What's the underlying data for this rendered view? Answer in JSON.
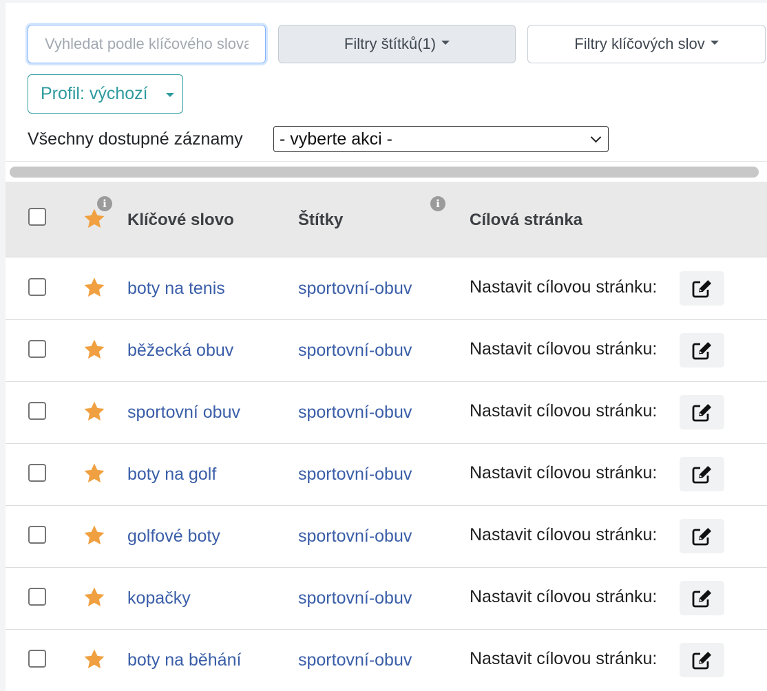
{
  "toolbar": {
    "search_placeholder": "Vyhledat podle klíčového slova",
    "tag_filter_label": "Filtry štítků(1)",
    "keyword_filter_label": "Filtry klíčových slov",
    "profile_label": "Profil: výchozí",
    "bulk_label": "Všechny dostupné záznamy",
    "bulk_action_value": "- vyberte akci -"
  },
  "table": {
    "headers": {
      "keyword": "Klíčové slovo",
      "tags": "Štítky",
      "target_page": "Cílová stránka",
      "info_glyph": "i"
    },
    "rows": [
      {
        "keyword": "boty na tenis",
        "tag": "sportovní-obuv",
        "target_label": "Nastavit cílovou stránku:"
      },
      {
        "keyword": "běžecká obuv",
        "tag": "sportovní-obuv",
        "target_label": "Nastavit cílovou stránku:"
      },
      {
        "keyword": "sportovní obuv",
        "tag": "sportovní-obuv",
        "target_label": "Nastavit cílovou stránku:"
      },
      {
        "keyword": "boty na golf",
        "tag": "sportovní-obuv",
        "target_label": "Nastavit cílovou stránku:"
      },
      {
        "keyword": "golfové boty",
        "tag": "sportovní-obuv",
        "target_label": "Nastavit cílovou stránku:"
      },
      {
        "keyword": "kopačky",
        "tag": "sportovní-obuv",
        "target_label": "Nastavit cílovou stránku:"
      },
      {
        "keyword": "boty na běhání",
        "tag": "sportovní-obuv",
        "target_label": "Nastavit cílovou stránku:"
      }
    ]
  },
  "colors": {
    "link": "#3a5ea8",
    "star": "#f0a040",
    "profile_accent": "#2f9a9e",
    "header_bg": "#e9e9e9"
  },
  "icons": {
    "star": "star-icon",
    "info": "info-icon",
    "edit": "edit-icon",
    "caret": "caret-down-icon"
  }
}
